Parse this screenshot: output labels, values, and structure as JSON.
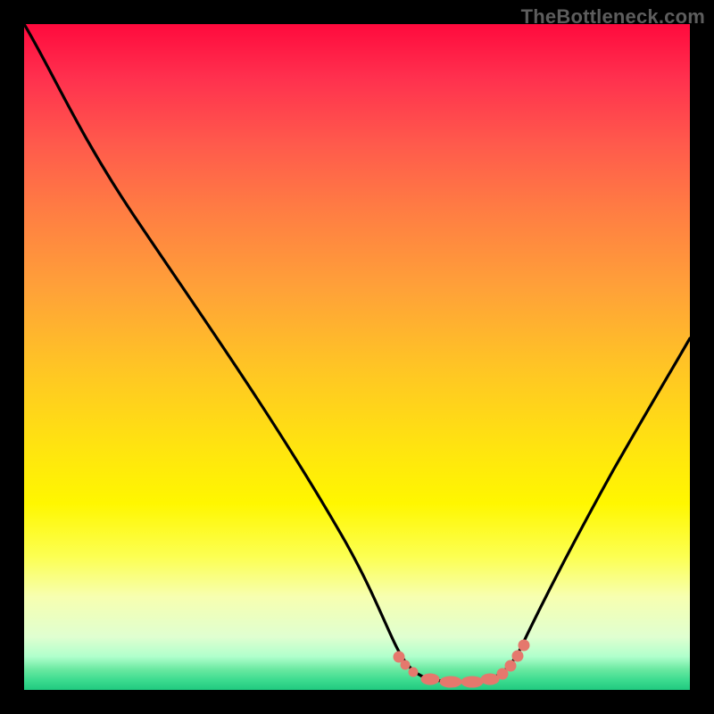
{
  "watermark": "TheBottleneck.com",
  "chart_data": {
    "type": "line",
    "title": "",
    "xlabel": "",
    "ylabel": "",
    "xlim": [
      0,
      100
    ],
    "ylim": [
      0,
      100
    ],
    "series": [
      {
        "name": "curve",
        "x": [
          0,
          6,
          20,
          35,
          48,
          54,
          56,
          58,
          60,
          62,
          65,
          68,
          70,
          72,
          75,
          80,
          88,
          96,
          100
        ],
        "y": [
          100,
          92,
          72,
          50,
          28,
          15,
          10,
          6,
          4,
          3,
          3,
          3,
          3.5,
          5,
          8,
          15,
          30,
          45,
          52
        ]
      },
      {
        "name": "bottom-markers",
        "x": [
          55,
          57,
          60,
          63,
          66,
          68,
          70,
          72,
          73
        ],
        "y": [
          8,
          5,
          3,
          3,
          3,
          4,
          5,
          8,
          11
        ]
      }
    ],
    "gradient_stops": [
      {
        "pos": 0,
        "color": "#ff0a3d"
      },
      {
        "pos": 50,
        "color": "#ffc624"
      },
      {
        "pos": 80,
        "color": "#fcff52"
      },
      {
        "pos": 100,
        "color": "#20c97f"
      }
    ]
  }
}
